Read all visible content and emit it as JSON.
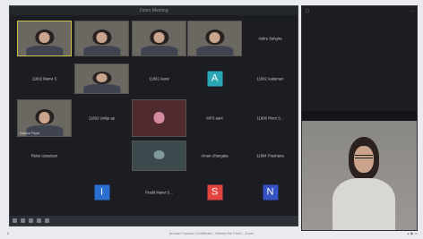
{
  "meeting": {
    "title": "Zoom Meeting",
    "participants": [
      {
        "id": "p1",
        "type": "video",
        "caption": "",
        "active": true
      },
      {
        "id": "p2",
        "type": "video",
        "caption": ""
      },
      {
        "id": "p3",
        "type": "video",
        "caption": ""
      },
      {
        "id": "p4",
        "type": "video",
        "caption": ""
      },
      {
        "id": "p5",
        "type": "name",
        "name": "Indira Sahgira"
      },
      {
        "id": "p6",
        "type": "name",
        "name": "11802 Manvi S"
      },
      {
        "id": "p7",
        "type": "video",
        "caption": ""
      },
      {
        "id": "p8",
        "type": "name",
        "name": "11802 Aasiv"
      },
      {
        "id": "p9",
        "type": "avatar",
        "letter": "A",
        "color": "#2aa6b4",
        "caption": ""
      },
      {
        "id": "p10",
        "type": "name",
        "name": "11802 Aadarvan"
      },
      {
        "id": "p11",
        "type": "video",
        "caption": "Sakshi Priyal"
      },
      {
        "id": "p12",
        "type": "name",
        "name": "11802 Ushja ap"
      },
      {
        "id": "p13",
        "type": "video",
        "caption": ""
      },
      {
        "id": "p14",
        "type": "name",
        "name": "MPS aant"
      },
      {
        "id": "p15",
        "type": "name",
        "name": "11806 Rinor S..."
      },
      {
        "id": "p16",
        "type": "name",
        "name": "Reiss Upsutsan"
      },
      {
        "id": "p17",
        "type": "video",
        "caption": ""
      },
      {
        "id": "p18",
        "type": "name",
        "name": "Aman Uhangata"
      },
      {
        "id": "p19",
        "type": "name",
        "name": "11804 Prashana"
      },
      {
        "id": "p20",
        "type": "avatar",
        "letter": "I",
        "color": "#2a6fd0",
        "caption": ""
      },
      {
        "id": "p21",
        "type": "name",
        "name": "Pradit Manvi S..."
      },
      {
        "id": "p22",
        "type": "avatar",
        "letter": "S",
        "color": "#e2453e",
        "caption": ""
      },
      {
        "id": "p23",
        "type": "avatar",
        "letter": "N",
        "color": "#3552c4",
        "caption": ""
      }
    ]
  },
  "footer": {
    "page_marker": "6",
    "caption": "Annual Function Certificate - Winnie the Pooh - Zoom",
    "icons_text": "▴ ◉ ▭"
  }
}
